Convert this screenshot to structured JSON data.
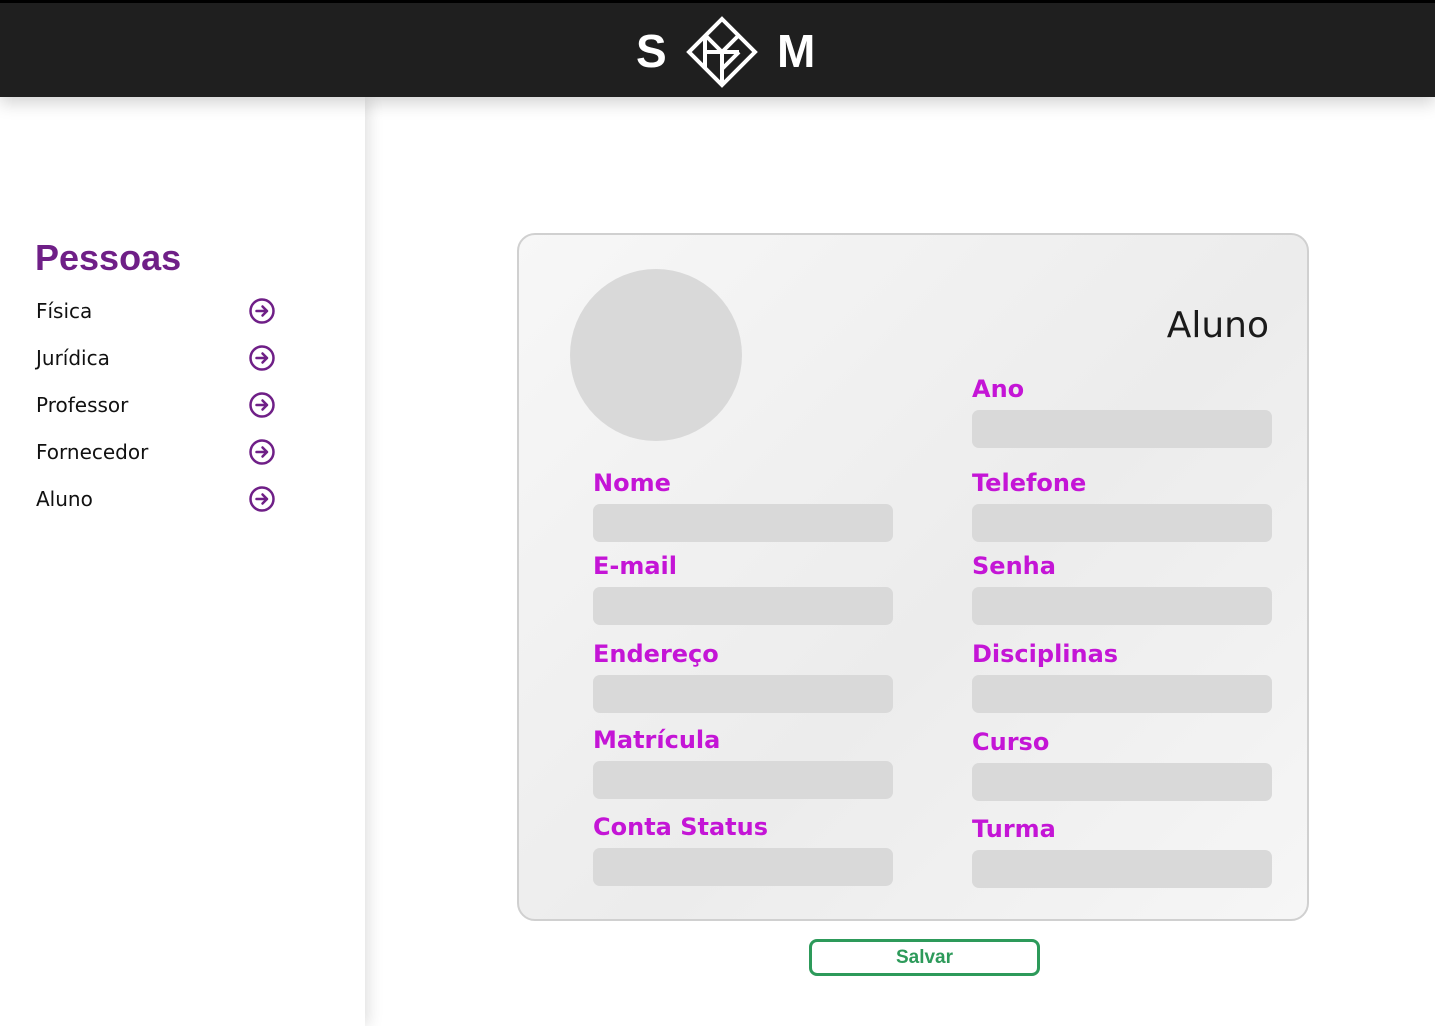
{
  "header": {
    "logo_left": "S",
    "logo_right": "M",
    "logo_icon": "diamond-cube-icon",
    "background": "#1f1f1f"
  },
  "sidebar": {
    "title": "Pessoas",
    "title_color": "#6f1f87",
    "items": [
      {
        "label": "Física",
        "icon": "arrow-right-circle-icon"
      },
      {
        "label": "Jurídica",
        "icon": "arrow-right-circle-icon"
      },
      {
        "label": "Professor",
        "icon": "arrow-right-circle-icon"
      },
      {
        "label": "Fornecedor",
        "icon": "arrow-right-circle-icon"
      },
      {
        "label": "Aluno",
        "icon": "arrow-right-circle-icon"
      }
    ]
  },
  "form": {
    "title": "Aluno",
    "label_color": "#c415d6",
    "left_fields": [
      {
        "label": "Nome",
        "value": ""
      },
      {
        "label": "E-mail",
        "value": ""
      },
      {
        "label": "Endereço",
        "value": ""
      },
      {
        "label": "Matrícula",
        "value": ""
      },
      {
        "label": "Conta Status",
        "value": ""
      }
    ],
    "right_fields": [
      {
        "label": "Ano",
        "value": ""
      },
      {
        "label": "Telefone",
        "value": ""
      },
      {
        "label": "Senha",
        "value": ""
      },
      {
        "label": "Disciplinas",
        "value": ""
      },
      {
        "label": "Curso",
        "value": ""
      },
      {
        "label": "Turma",
        "value": ""
      }
    ],
    "save_label": "Salvar",
    "save_color": "#2d9a5a"
  }
}
